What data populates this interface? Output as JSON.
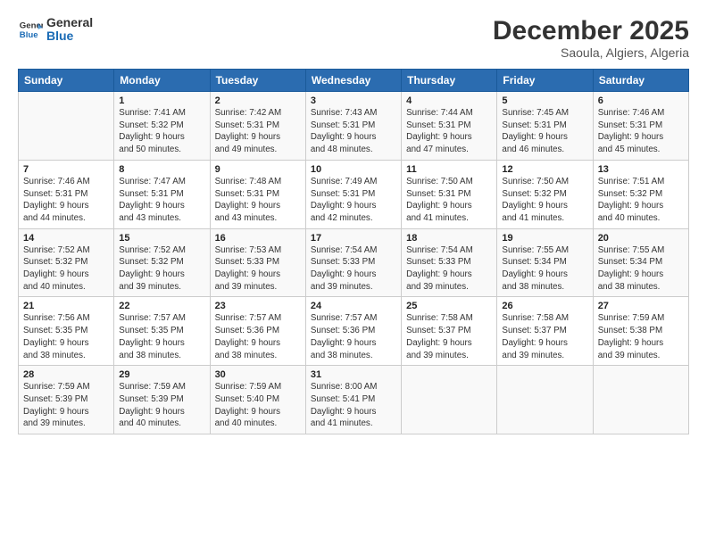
{
  "logo": {
    "line1": "General",
    "line2": "Blue"
  },
  "title": "December 2025",
  "subtitle": "Saoula, Algiers, Algeria",
  "days_header": [
    "Sunday",
    "Monday",
    "Tuesday",
    "Wednesday",
    "Thursday",
    "Friday",
    "Saturday"
  ],
  "weeks": [
    [
      {
        "day": "",
        "info": ""
      },
      {
        "day": "1",
        "info": "Sunrise: 7:41 AM\nSunset: 5:32 PM\nDaylight: 9 hours\nand 50 minutes."
      },
      {
        "day": "2",
        "info": "Sunrise: 7:42 AM\nSunset: 5:31 PM\nDaylight: 9 hours\nand 49 minutes."
      },
      {
        "day": "3",
        "info": "Sunrise: 7:43 AM\nSunset: 5:31 PM\nDaylight: 9 hours\nand 48 minutes."
      },
      {
        "day": "4",
        "info": "Sunrise: 7:44 AM\nSunset: 5:31 PM\nDaylight: 9 hours\nand 47 minutes."
      },
      {
        "day": "5",
        "info": "Sunrise: 7:45 AM\nSunset: 5:31 PM\nDaylight: 9 hours\nand 46 minutes."
      },
      {
        "day": "6",
        "info": "Sunrise: 7:46 AM\nSunset: 5:31 PM\nDaylight: 9 hours\nand 45 minutes."
      }
    ],
    [
      {
        "day": "7",
        "info": "Sunrise: 7:46 AM\nSunset: 5:31 PM\nDaylight: 9 hours\nand 44 minutes."
      },
      {
        "day": "8",
        "info": "Sunrise: 7:47 AM\nSunset: 5:31 PM\nDaylight: 9 hours\nand 43 minutes."
      },
      {
        "day": "9",
        "info": "Sunrise: 7:48 AM\nSunset: 5:31 PM\nDaylight: 9 hours\nand 43 minutes."
      },
      {
        "day": "10",
        "info": "Sunrise: 7:49 AM\nSunset: 5:31 PM\nDaylight: 9 hours\nand 42 minutes."
      },
      {
        "day": "11",
        "info": "Sunrise: 7:50 AM\nSunset: 5:31 PM\nDaylight: 9 hours\nand 41 minutes."
      },
      {
        "day": "12",
        "info": "Sunrise: 7:50 AM\nSunset: 5:32 PM\nDaylight: 9 hours\nand 41 minutes."
      },
      {
        "day": "13",
        "info": "Sunrise: 7:51 AM\nSunset: 5:32 PM\nDaylight: 9 hours\nand 40 minutes."
      }
    ],
    [
      {
        "day": "14",
        "info": "Sunrise: 7:52 AM\nSunset: 5:32 PM\nDaylight: 9 hours\nand 40 minutes."
      },
      {
        "day": "15",
        "info": "Sunrise: 7:52 AM\nSunset: 5:32 PM\nDaylight: 9 hours\nand 39 minutes."
      },
      {
        "day": "16",
        "info": "Sunrise: 7:53 AM\nSunset: 5:33 PM\nDaylight: 9 hours\nand 39 minutes."
      },
      {
        "day": "17",
        "info": "Sunrise: 7:54 AM\nSunset: 5:33 PM\nDaylight: 9 hours\nand 39 minutes."
      },
      {
        "day": "18",
        "info": "Sunrise: 7:54 AM\nSunset: 5:33 PM\nDaylight: 9 hours\nand 39 minutes."
      },
      {
        "day": "19",
        "info": "Sunrise: 7:55 AM\nSunset: 5:34 PM\nDaylight: 9 hours\nand 38 minutes."
      },
      {
        "day": "20",
        "info": "Sunrise: 7:55 AM\nSunset: 5:34 PM\nDaylight: 9 hours\nand 38 minutes."
      }
    ],
    [
      {
        "day": "21",
        "info": "Sunrise: 7:56 AM\nSunset: 5:35 PM\nDaylight: 9 hours\nand 38 minutes."
      },
      {
        "day": "22",
        "info": "Sunrise: 7:57 AM\nSunset: 5:35 PM\nDaylight: 9 hours\nand 38 minutes."
      },
      {
        "day": "23",
        "info": "Sunrise: 7:57 AM\nSunset: 5:36 PM\nDaylight: 9 hours\nand 38 minutes."
      },
      {
        "day": "24",
        "info": "Sunrise: 7:57 AM\nSunset: 5:36 PM\nDaylight: 9 hours\nand 38 minutes."
      },
      {
        "day": "25",
        "info": "Sunrise: 7:58 AM\nSunset: 5:37 PM\nDaylight: 9 hours\nand 39 minutes."
      },
      {
        "day": "26",
        "info": "Sunrise: 7:58 AM\nSunset: 5:37 PM\nDaylight: 9 hours\nand 39 minutes."
      },
      {
        "day": "27",
        "info": "Sunrise: 7:59 AM\nSunset: 5:38 PM\nDaylight: 9 hours\nand 39 minutes."
      }
    ],
    [
      {
        "day": "28",
        "info": "Sunrise: 7:59 AM\nSunset: 5:39 PM\nDaylight: 9 hours\nand 39 minutes."
      },
      {
        "day": "29",
        "info": "Sunrise: 7:59 AM\nSunset: 5:39 PM\nDaylight: 9 hours\nand 40 minutes."
      },
      {
        "day": "30",
        "info": "Sunrise: 7:59 AM\nSunset: 5:40 PM\nDaylight: 9 hours\nand 40 minutes."
      },
      {
        "day": "31",
        "info": "Sunrise: 8:00 AM\nSunset: 5:41 PM\nDaylight: 9 hours\nand 41 minutes."
      },
      {
        "day": "",
        "info": ""
      },
      {
        "day": "",
        "info": ""
      },
      {
        "day": "",
        "info": ""
      }
    ]
  ]
}
